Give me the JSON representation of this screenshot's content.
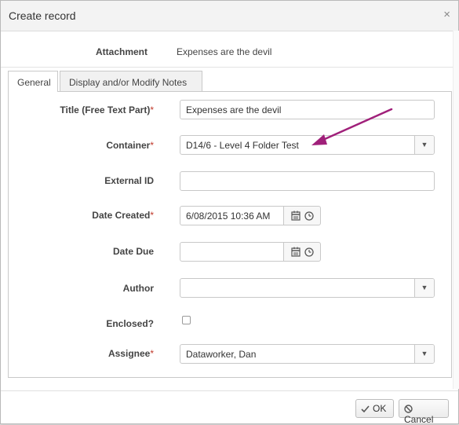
{
  "dialog": {
    "title": "Create record",
    "close_symbol": "×"
  },
  "attachment": {
    "label": "Attachment",
    "value": "Expenses are the devil"
  },
  "tabs": [
    {
      "label": "General",
      "active": true
    },
    {
      "label": "Display and/or Modify Notes",
      "active": false
    }
  ],
  "form": {
    "title_label": "Title (Free Text Part)",
    "title_value": "Expenses are the devil",
    "container_label": "Container",
    "container_value": "D14/6 - Level 4 Folder Test",
    "external_id_label": "External ID",
    "external_id_value": "",
    "date_created_label": "Date Created",
    "date_created_value": "6/08/2015 10:36 AM",
    "date_due_label": "Date Due",
    "date_due_value": "",
    "author_label": "Author",
    "author_value": "",
    "enclosed_label": "Enclosed?",
    "enclosed_checked": false,
    "assignee_label": "Assignee",
    "assignee_value": "Dataworker, Dan",
    "required_marker": "*"
  },
  "buttons": {
    "ok_label": "OK",
    "cancel_label": "Cancel"
  },
  "icons": {
    "dropdown": "chevron-down-icon",
    "calendar": "calendar-icon",
    "clock": "clock-icon",
    "ok": "check-icon",
    "cancel": "ban-icon",
    "annotation": "arrow-annotation"
  },
  "colors": {
    "required": "#c0392b",
    "annotation_arrow": "#a0207a"
  }
}
